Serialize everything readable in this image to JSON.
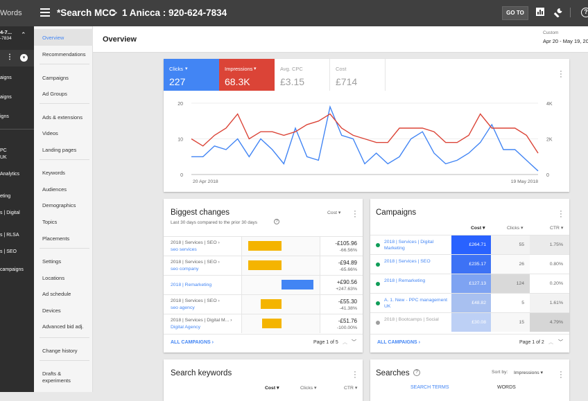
{
  "topbar": {
    "brand": "Words",
    "breadcrumb_root": "*Search MCC",
    "separator": ">",
    "account": "1 Anicca : 920-624-7834",
    "goto_label": "GO TO"
  },
  "rail": {
    "acct_line1": "4-7...",
    "acct_line2": "-7834",
    "items": [
      "aigns",
      "aigns",
      "igns",
      "PC",
      "UK",
      "Analytics",
      "eting",
      "s | Digital",
      "s | RLSA",
      "s | SEO",
      "campaigns"
    ]
  },
  "nav": {
    "items": [
      "Overview",
      "Recommendations",
      "Campaigns",
      "Ad Groups",
      "Ads & extensions",
      "Videos",
      "Landing pages",
      "Keywords",
      "Audiences",
      "Demographics",
      "Topics",
      "Placements",
      "Settings",
      "Locations",
      "Ad schedule",
      "Devices",
      "Advanced bid adj.",
      "Change history",
      "Drafts &",
      "experiments"
    ]
  },
  "header": {
    "title": "Overview",
    "range_label": "Custom",
    "dates": "Apr 20 - May 19, 20"
  },
  "metrics": [
    {
      "label": "Clicks",
      "value": "227",
      "bg": "#4285f4",
      "color": "#ffffff",
      "dropdown": true
    },
    {
      "label": "Impressions",
      "value": "68.3K",
      "bg": "#db4437",
      "color": "#ffffff",
      "dropdown": true
    },
    {
      "label": "Avg. CPC",
      "value": "£3.15",
      "bg": "#ffffff",
      "color": "#9e9e9e",
      "dropdown": false
    },
    {
      "label": "Cost",
      "value": "£714",
      "bg": "#ffffff",
      "color": "#9e9e9e",
      "dropdown": false
    }
  ],
  "chart_data": {
    "type": "line",
    "x_start": "20 Apr 2018",
    "x_end": "19 May 2018",
    "y_left_ticks": [
      "20",
      "10",
      "0"
    ],
    "y_right_ticks": [
      "4K",
      "2K",
      "0"
    ],
    "ylim_left": [
      0,
      20
    ],
    "ylim_right": [
      0,
      4000
    ],
    "series": [
      {
        "name": "Clicks",
        "color": "#4285f4",
        "axis": "left",
        "values": [
          5,
          5,
          8,
          7,
          10,
          5,
          10,
          7,
          3,
          13,
          5,
          4,
          19,
          11,
          10,
          3,
          6,
          3,
          5,
          10,
          12,
          6,
          3,
          4,
          6,
          9,
          14,
          7,
          7,
          4,
          1
        ]
      },
      {
        "name": "Impressions",
        "color": "#db4437",
        "axis": "left",
        "values": [
          10,
          8,
          11,
          13,
          17,
          10,
          12,
          12,
          11,
          12,
          14,
          15,
          17,
          13,
          11,
          10,
          9,
          9,
          13,
          13,
          13,
          12,
          9,
          9,
          11,
          17,
          13,
          13,
          13,
          11,
          6
        ]
      }
    ]
  },
  "biggest": {
    "title": "Biggest changes",
    "subtitle": "Last 30 days compared to the prior 30 days",
    "sort": "Cost",
    "rows": [
      {
        "line1": "2018 | Services | SEO ›",
        "line2": "seo services",
        "delta": "-£105.96",
        "pct": "-66.56%"
      },
      {
        "line1": "2018 | Services | SEO ›",
        "line2": "seo company",
        "delta": "-£94.89",
        "pct": "-65.66%"
      },
      {
        "line1": "2018 | Remarketing",
        "line2": "",
        "delta": "+£90.56",
        "pct": "+247.63%"
      },
      {
        "line1": "2018 | Services | SEO ›",
        "line2": "seo agency",
        "delta": "-£55.30",
        "pct": "-41.38%"
      },
      {
        "line1": "2018 | Services | Digital M... ›",
        "line2": "Digital Agency",
        "delta": "-£51.76",
        "pct": "-100.00%"
      }
    ],
    "all_label": "ALL CAMPAIGNS",
    "pager": "Page 1 of 5"
  },
  "campaigns": {
    "title": "Campaigns",
    "col_cost": "Cost",
    "col_clicks": "Clicks",
    "col_ctr": "CTR",
    "rows": [
      {
        "name": "2018 | Services | Digital Marketing",
        "cost": "£264.71",
        "clicks": "55",
        "ctr": "1.75%",
        "status": "#0f9d58"
      },
      {
        "name": "2018 | Services | SEO",
        "cost": "£235.17",
        "clicks": "26",
        "ctr": "0.80%",
        "status": "#0f9d58"
      },
      {
        "name": "2018 | Remarketing",
        "cost": "£127.13",
        "clicks": "124",
        "ctr": "0.20%",
        "status": "#0f9d58"
      },
      {
        "name": "A. 1. New - PPC management UK",
        "cost": "£48.82",
        "clicks": "5",
        "ctr": "1.61%",
        "status": "#0f9d58"
      },
      {
        "name": "2018 | Bootcamps | Social",
        "cost": "£30.08",
        "clicks": "15",
        "ctr": "4.79%",
        "status": "#9e9e9e"
      }
    ],
    "all_label": "ALL CAMPAIGNS",
    "pager": "Page 1 of 2"
  },
  "search_keywords": {
    "title": "Search keywords",
    "col_cost": "Cost",
    "col_clicks": "Clicks",
    "col_ctr": "CTR"
  },
  "searches": {
    "title": "Searches",
    "sort_label": "Sort by:",
    "sort_value": "Impressions",
    "tab1": "SEARCH TERMS",
    "tab2": "WORDS"
  }
}
